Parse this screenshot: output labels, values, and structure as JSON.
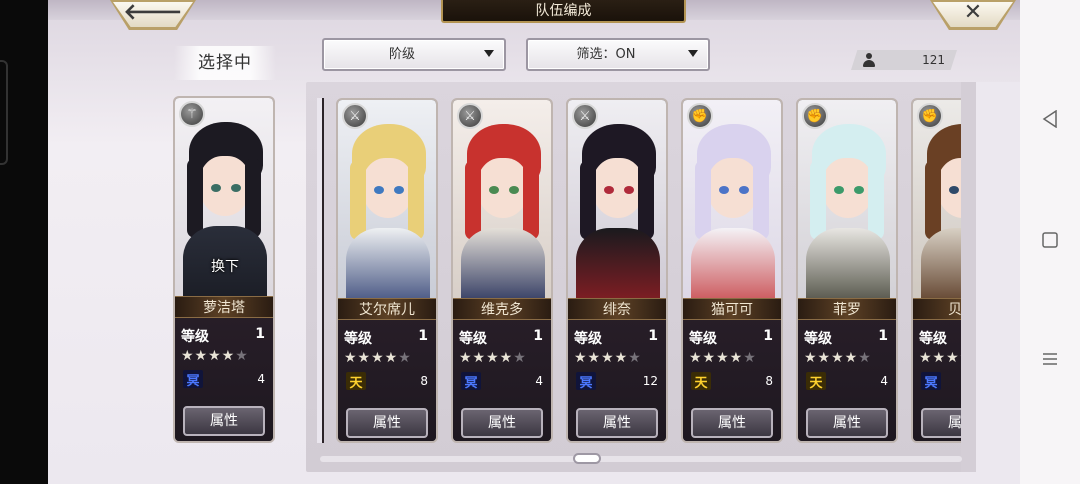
{
  "header": {
    "title": "队伍编成",
    "back_glyph": "🡐",
    "close_glyph": "✕"
  },
  "selecting_label": "选择中",
  "filters": {
    "rank_label": "阶级",
    "filter_label": "筛选：ON"
  },
  "count": "121",
  "selected_card": {
    "name": "萝洁塔",
    "swap": "换下",
    "level_label": "等级",
    "level": "1",
    "stars_on": "★★★★",
    "stars_off": "★",
    "rank": "冥",
    "rank_type": "ming",
    "cost": "4",
    "attr": "属性",
    "weapon_icon": "spear-icon",
    "weapon_glyph": "⚚"
  },
  "cards": [
    {
      "name": "艾尔席儿",
      "level_label": "等级",
      "level": "1",
      "stars_on": "★★★★",
      "stars_off": "★",
      "rank": "天",
      "rank_type": "tian",
      "cost": "8",
      "attr": "属性",
      "weapon_icon": "sword-icon",
      "weapon_glyph": "⚔"
    },
    {
      "name": "维克多",
      "level_label": "等级",
      "level": "1",
      "stars_on": "★★★★",
      "stars_off": "★",
      "rank": "冥",
      "rank_type": "ming",
      "cost": "4",
      "attr": "属性",
      "weapon_icon": "sword-icon",
      "weapon_glyph": "⚔"
    },
    {
      "name": "绯奈",
      "level_label": "等级",
      "level": "1",
      "stars_on": "★★★★",
      "stars_off": "★",
      "rank": "冥",
      "rank_type": "ming",
      "cost": "12",
      "attr": "属性",
      "weapon_icon": "katana-icon",
      "weapon_glyph": "⚔"
    },
    {
      "name": "猫可可",
      "level_label": "等级",
      "level": "1",
      "stars_on": "★★★★",
      "stars_off": "★",
      "rank": "天",
      "rank_type": "tian",
      "cost": "8",
      "attr": "属性",
      "weapon_icon": "fist-icon",
      "weapon_glyph": "✊"
    },
    {
      "name": "菲罗",
      "level_label": "等级",
      "level": "1",
      "stars_on": "★★★★",
      "stars_off": "★",
      "rank": "天",
      "rank_type": "tian",
      "cost": "4",
      "attr": "属性",
      "weapon_icon": "fist-icon",
      "weapon_glyph": "✊"
    },
    {
      "name": "贝尼",
      "level_label": "等级",
      "level": "1",
      "stars_on": "★★★★",
      "stars_off": "★",
      "rank": "冥",
      "rank_type": "ming",
      "cost": "",
      "attr": "属性",
      "weapon_icon": "fist-icon",
      "weapon_glyph": "✊"
    }
  ],
  "colors": {
    "rank_ming": "#4b78ff",
    "rank_tian": "#ffd22e",
    "title_border": "#b39453"
  }
}
